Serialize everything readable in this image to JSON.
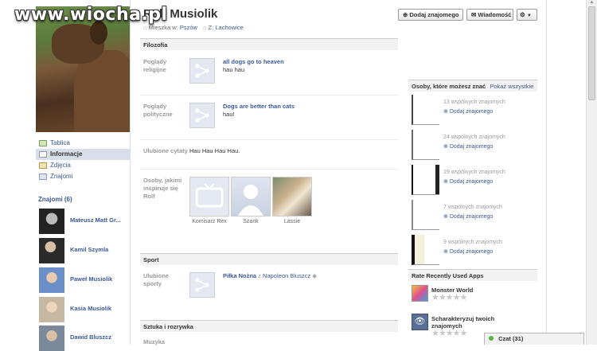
{
  "watermark": "www.wiocha.pl",
  "profile": {
    "name": "Rolf Musiolik",
    "lives_label": "Mieszka w:",
    "lives_city": "Pszów",
    "from_label": "Z:",
    "from_city": "Lachowice"
  },
  "actions": {
    "add_friend": "Dodaj znajomego",
    "message": "Wiadomość"
  },
  "menu": [
    {
      "label": "Tablica",
      "icon": "wall-icon"
    },
    {
      "label": "Informacje",
      "icon": "info-icon"
    },
    {
      "label": "Zdjęcia",
      "icon": "photos-icon"
    },
    {
      "label": "Znajomi",
      "icon": "friends-icon"
    }
  ],
  "friends": {
    "title": "Znajomi (6)",
    "items": [
      "Mateusz Matt Gr...",
      "Kamil Szymla",
      "Paweł Musiolik",
      "Kasia Musiolik",
      "Dawid Bluszcz"
    ]
  },
  "sections": {
    "philosophy": {
      "title": "Filozofia",
      "religion_label": "Poglądy religijne",
      "religion_title": "all dogs go to heaven",
      "religion_desc": "hau hau",
      "politics_label": "Poglądy polityczne",
      "politics_title": "Dogs are better than cats",
      "politics_desc": "hau!",
      "quotes_label": "Ulubione cytaty",
      "quotes_value": "Hau Hau Hau Hau.",
      "inspire_label": "Osoby, jakimi inspiruje się Rolf",
      "inspire_people": [
        "Komisarz Rex",
        "Szarik",
        "Lassie"
      ]
    },
    "sport": {
      "title": "Sport",
      "label": "Ulubione sporty",
      "sport_title": "Piłka Nożna",
      "with_text": "z",
      "with_person": "Napoleon Bluszcz"
    },
    "art": {
      "title": "Sztuka i rozrywka",
      "label": "Muzyka"
    }
  },
  "suggestions": {
    "title": "Osoby, które możesz znać",
    "show_all": "Pokaż wszystkie",
    "add_label": "Dodaj znajomego",
    "items": [
      "13 wspólnych znajomych",
      "24 wspólnych znajomych",
      "19 wspólnych znajomych",
      "7 wspólnych znajomych",
      "9 wspólnych znajomych"
    ]
  },
  "apps": {
    "title": "Rate Recently Used Apps",
    "items": [
      {
        "name": "Monster World",
        "rating": 0,
        "max": 5
      },
      {
        "name": "Scharakteryzuj twoich znajomych",
        "rating": 0,
        "max": 5
      }
    ]
  },
  "chat": {
    "label": "Czat (31)"
  },
  "colors": {
    "link": "#3b5998",
    "section_bg": "#f2f2f2",
    "online": "#5cb23f"
  }
}
